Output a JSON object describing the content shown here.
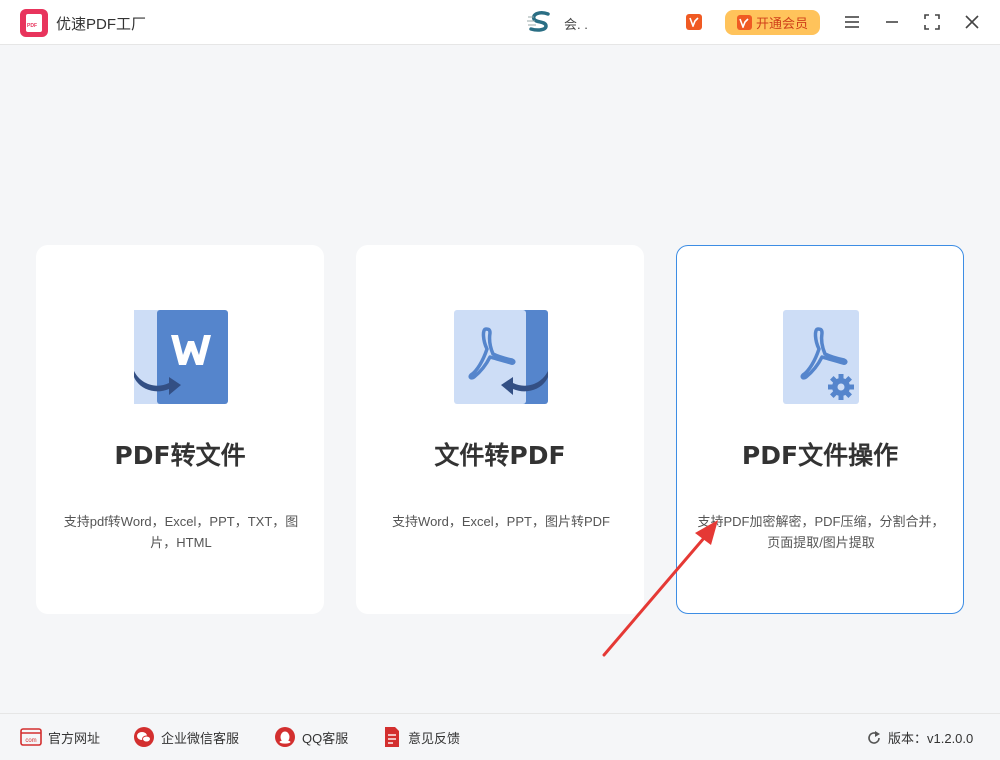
{
  "app": {
    "title": "优速PDF工厂",
    "logo_text": "PDF",
    "user_name": "会. .",
    "vip_label": "开通会员"
  },
  "window_controls": [
    "menu-icon",
    "minimize-icon",
    "maximize-icon",
    "close-icon"
  ],
  "cards": [
    {
      "title": "PDF转文件",
      "desc": "支持pdf转Word，Excel，PPT，TXT，图片，HTML",
      "icon": "pdf-to-word-icon"
    },
    {
      "title": "文件转PDF",
      "desc": "支持Word，Excel，PPT，图片转PDF",
      "icon": "file-to-pdf-icon"
    },
    {
      "title": "PDF文件操作",
      "desc": "支持PDF加密解密，PDF压缩，分割合并，页面提取/图片提取",
      "icon": "pdf-tools-icon"
    }
  ],
  "footer": {
    "links": [
      {
        "label": "官方网址",
        "icon": "website-icon"
      },
      {
        "label": "企业微信客服",
        "icon": "wechat-icon"
      },
      {
        "label": "QQ客服",
        "icon": "qq-icon"
      },
      {
        "label": "意见反馈",
        "icon": "feedback-icon"
      }
    ],
    "version": "版本：v1.2.0.0"
  },
  "colors": {
    "accent_blue": "#3d8de4",
    "brand_red": "#e8345c",
    "vip_orange": "#ffc35b",
    "icon_blue": "#5585cc",
    "icon_light": "#cdddf6"
  }
}
